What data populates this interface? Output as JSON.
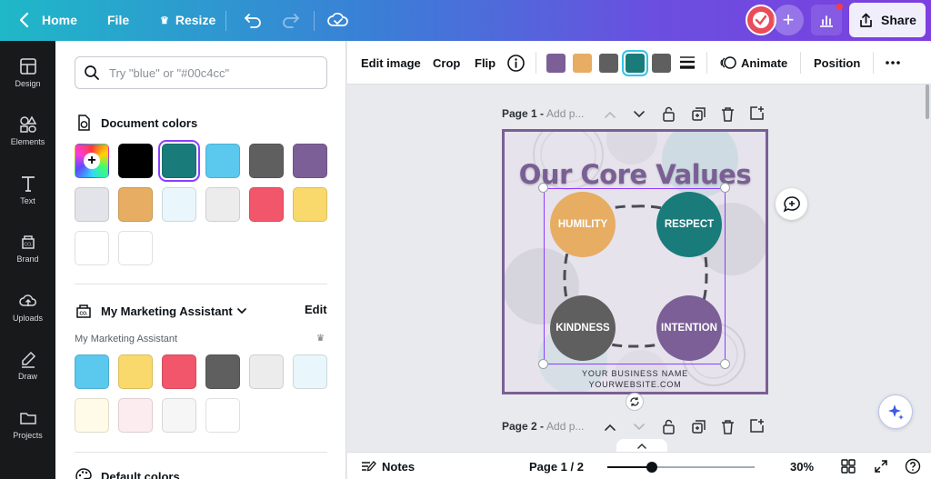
{
  "topbar": {
    "home_label": "Home",
    "file_label": "File",
    "resize_label": "Resize",
    "share_label": "Share"
  },
  "rail": {
    "items": [
      {
        "label": "Design",
        "icon": "layout-icon"
      },
      {
        "label": "Elements",
        "icon": "shapes-icon"
      },
      {
        "label": "Text",
        "icon": "text-icon"
      },
      {
        "label": "Brand",
        "icon": "brand-icon"
      },
      {
        "label": "Uploads",
        "icon": "upload-cloud-icon"
      },
      {
        "label": "Draw",
        "icon": "pen-icon"
      },
      {
        "label": "Projects",
        "icon": "folder-icon"
      }
    ]
  },
  "panel": {
    "search_placeholder": "Try \"blue\" or \"#00c4cc\"",
    "document_colors_title": "Document colors",
    "document_colors": [
      "#000000",
      "#1a7b7b",
      "#5bc8ee",
      "#5f5f5f",
      "#7b5f96",
      "#e3e3ea",
      "#e6ad63",
      "#e9f6fb",
      "#ececec",
      "#f2566a",
      "#f9d96c",
      "#ffffff",
      "#ffffff"
    ],
    "selected_document_color": "#1a7b7b",
    "brand_kit_title": "My Marketing Assistant",
    "edit_label": "Edit",
    "brand_sub_label": "My Marketing Assistant",
    "brand_colors": [
      "#5bc8ee",
      "#f9d96c",
      "#f2566a",
      "#5f5f5f",
      "#ececec",
      "#e9f6fb",
      "#fffbe8",
      "#fdecef",
      "#f6f6f6",
      "#ffffff"
    ],
    "default_colors_title": "Default colors"
  },
  "toolbar": {
    "edit_image": "Edit image",
    "crop": "Crop",
    "flip": "Flip",
    "animate": "Animate",
    "position": "Position",
    "swatches": [
      "#7b5f96",
      "#e6ad63",
      "#5f5f5f",
      "#1a7b7b",
      "#5f5f5f"
    ],
    "selected_swatch_index": 3
  },
  "canvas": {
    "page1_label": "Page 1 -",
    "page1_title_placeholder": "Add p...",
    "page2_label": "Page 2 -",
    "page2_title_placeholder": "Add p...",
    "design": {
      "title": "Our Core Values",
      "values": [
        {
          "label": "HUMILITY",
          "color": "#e6ad63"
        },
        {
          "label": "RESPECT",
          "color": "#1a7b7b"
        },
        {
          "label": "KINDNESS",
          "color": "#5f5f5f"
        },
        {
          "label": "INTENTION",
          "color": "#7b5f96"
        }
      ],
      "business_name": "YOUR BUSINESS NAME",
      "website": "YOURWEBSITE.COM",
      "frame_color": "#7a5f94"
    }
  },
  "bottombar": {
    "notes_label": "Notes",
    "page_indicator": "Page 1 / 2",
    "zoom_label": "30%",
    "zoom_value": 30
  }
}
